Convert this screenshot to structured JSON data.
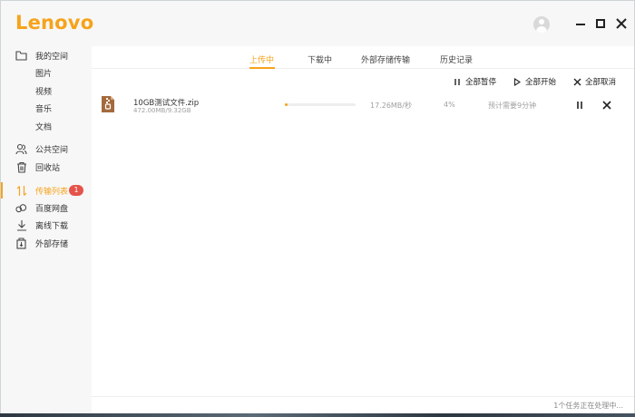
{
  "app": {
    "logo": "Lenovo",
    "brand_color": "#f6a31b",
    "window_buttons": [
      "minimize-icon",
      "maximize-icon",
      "close-icon"
    ]
  },
  "sidebar": {
    "items": [
      {
        "label": "我的空间",
        "icon": "folder-icon"
      },
      {
        "label": "图片"
      },
      {
        "label": "视频"
      },
      {
        "label": "音乐"
      },
      {
        "label": "文档"
      },
      {
        "label": "公共空间",
        "icon": "users-icon"
      },
      {
        "label": "回收站",
        "icon": "trash-icon"
      },
      {
        "label": "传输列表",
        "icon": "transfer-icon",
        "badge": "1",
        "active": true
      },
      {
        "label": "百度网盘",
        "icon": "baidu-icon"
      },
      {
        "label": "离线下载",
        "icon": "download-icon"
      },
      {
        "label": "外部存储",
        "icon": "external-storage-icon"
      }
    ]
  },
  "tabs": [
    {
      "label": "上传中",
      "active": true
    },
    {
      "label": "下载中"
    },
    {
      "label": "外部存储传输"
    },
    {
      "label": "历史记录"
    }
  ],
  "toolbar": {
    "pause_all": "全部暂停",
    "start_all": "全部开始",
    "cancel_all": "全部取消"
  },
  "transfers": [
    {
      "name": "10GB测试文件.zip",
      "size": "472.00MB/9.32GB",
      "progress": 0.04,
      "speed": "17.26MB/秒",
      "percent": "4%",
      "eta": "预计需要9分钟"
    }
  ],
  "status": {
    "text": "1个任务正在处理中..."
  }
}
